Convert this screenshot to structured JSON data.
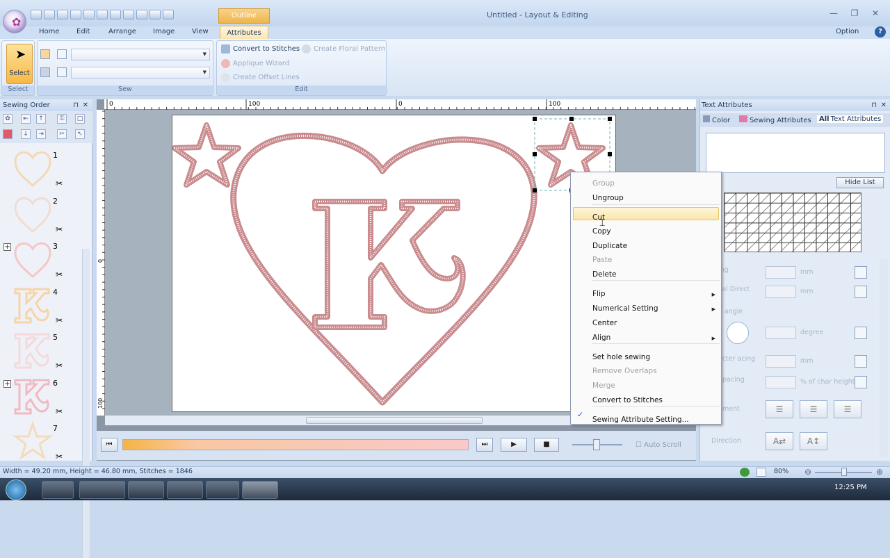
{
  "window": {
    "title": "Untitled - Layout & Editing",
    "context_tab": "Outline",
    "option": "Option",
    "help": "?"
  },
  "tabs": [
    "Home",
    "Edit",
    "Arrange",
    "Image",
    "View",
    "Attributes"
  ],
  "ribbon": {
    "select_label": "Select",
    "groups": {
      "select": "Select",
      "sew": "Sew",
      "edit": "Edit"
    },
    "edit_buttons": {
      "convert": "Convert to Stitches",
      "floral": "Create Floral Pattern",
      "applique": "Applique Wizard",
      "offset": "Create Offset Lines"
    }
  },
  "sewing_order": {
    "title": "Sewing Order",
    "items": [
      {
        "num": "1",
        "shape": "heart",
        "color": "#f3d9b5"
      },
      {
        "num": "2",
        "shape": "heart",
        "color": "#f1dcd1"
      },
      {
        "num": "3",
        "shape": "heart",
        "color": "#f5c6c6"
      },
      {
        "num": "4",
        "shape": "k",
        "color": "#f6d3a8"
      },
      {
        "num": "5",
        "shape": "k",
        "color": "#f4dada"
      },
      {
        "num": "6",
        "shape": "k",
        "color": "#f0b9c0"
      },
      {
        "num": "7",
        "shape": "star",
        "color": "#f3dcbc"
      }
    ]
  },
  "ruler": {
    "h_ticks": [
      "0",
      "100",
      "0",
      "100"
    ],
    "v_ticks": [
      "0",
      "100"
    ]
  },
  "context_menu": {
    "items": [
      {
        "label": "Group",
        "disabled": true
      },
      {
        "label": "Ungroup",
        "disabled": false
      },
      {
        "label": "Cut",
        "disabled": false,
        "highlighted": true
      },
      {
        "label": "Copy",
        "disabled": false
      },
      {
        "label": "Duplicate",
        "disabled": false
      },
      {
        "label": "Paste",
        "disabled": true
      },
      {
        "label": "Delete",
        "disabled": false
      },
      {
        "label": "Flip",
        "disabled": false,
        "submenu": true
      },
      {
        "label": "Numerical Setting",
        "disabled": false,
        "submenu": true
      },
      {
        "label": "Center",
        "disabled": false
      },
      {
        "label": "Align",
        "disabled": false,
        "submenu": true
      },
      {
        "label": "Set hole sewing",
        "disabled": false
      },
      {
        "label": "Remove Overlaps",
        "disabled": true
      },
      {
        "label": "Merge",
        "disabled": true
      },
      {
        "label": "Convert to Stitches",
        "disabled": false
      },
      {
        "label": "Sewing Attribute Setting...",
        "disabled": false,
        "checked": true
      }
    ]
  },
  "text_attributes": {
    "title": "Text Attributes",
    "tabs": [
      "Color",
      "Sewing Attributes",
      "Text Attributes"
    ],
    "hide_list": "Hide List",
    "rows": [
      {
        "label": "ing",
        "unit": "mm"
      },
      {
        "label": "cal Direct",
        "unit": "mm"
      },
      {
        "label": "e angle",
        "unit": ""
      },
      {
        "label": "",
        "unit": "degree"
      },
      {
        "label": "acter acing",
        "unit": "mm"
      },
      {
        "label": "Spacing",
        "unit": "% of char height"
      },
      {
        "label": "nment",
        "unit": ""
      },
      {
        "label": "Direction",
        "unit": ""
      }
    ]
  },
  "playback": {
    "auto_scroll": "Auto Scroll"
  },
  "status": {
    "text": "Width = 49.20 mm, Height = 46.80 mm, Stitches = 1846",
    "zoom": "80%"
  },
  "taskbar": {
    "clock": "12:25 PM"
  },
  "colors": {
    "outline": "#c98b8e",
    "accent": "#f7b844"
  }
}
